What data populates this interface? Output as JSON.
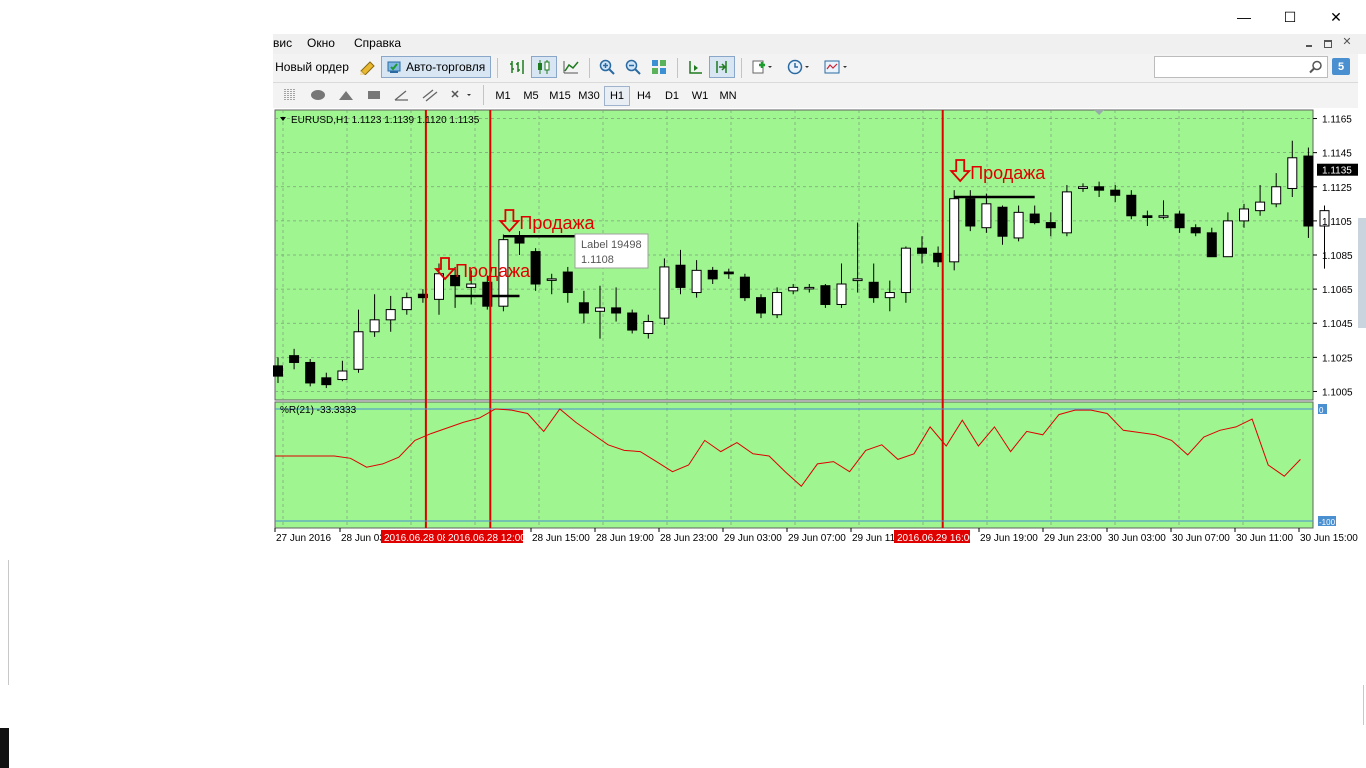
{
  "window": {
    "minimize_glyph": "—",
    "maximize_glyph": "☐",
    "close_glyph": "✕"
  },
  "menu": [
    {
      "label": "вис"
    },
    {
      "label": "Окно"
    },
    {
      "label": "Справка"
    }
  ],
  "toolbar": {
    "new_order_label": "Новый ордер",
    "autotrading_label": "Авто-торговля",
    "search_placeholder": "",
    "notification_count": "5"
  },
  "timeframes": [
    "M1",
    "M5",
    "M15",
    "M30",
    "H1",
    "H4",
    "D1",
    "W1",
    "MN"
  ],
  "active_timeframe": "H1",
  "chart_data": [
    {
      "type": "candlestick",
      "title": "EURUSD,H1  1.1123 1.1139 1.1120 1.1135",
      "price_scale": [
        "1.1165",
        "1.1145",
        "1.1125",
        "1.1105",
        "1.1085",
        "1.1065",
        "1.1045",
        "1.1025",
        "1.1005"
      ],
      "current_price": "1.1135",
      "y_range": [
        1.1,
        1.117
      ],
      "time_labels": [
        "27 Jun 2016",
        "28 Jun 03",
        "28 Jun 15:00",
        "28 Jun 19:00",
        "28 Jun 23:00",
        "29 Jun 03:00",
        "29 Jun 07:00",
        "29 Jun 11",
        "29 Jun 19:00",
        "29 Jun 23:00",
        "30 Jun 03:00",
        "30 Jun 07:00",
        "30 Jun 11:00",
        "30 Jun 15:00"
      ],
      "highlighted_times": [
        "2016.06.28 08",
        "2016.06.28 12:00",
        "2016.06.29 16:00"
      ],
      "candles": [
        [
          1.102,
          1.1014,
          1.1025,
          1.101
        ],
        [
          1.1026,
          1.1022,
          1.103,
          1.1018
        ],
        [
          1.1022,
          1.101,
          1.1024,
          1.1008
        ],
        [
          1.1013,
          1.1009,
          1.1016,
          1.1007
        ],
        [
          1.1012,
          1.1017,
          1.1023,
          1.1011
        ],
        [
          1.1018,
          1.104,
          1.1053,
          1.1016
        ],
        [
          1.104,
          1.1047,
          1.1062,
          1.1037
        ],
        [
          1.1047,
          1.1053,
          1.1061,
          1.104
        ],
        [
          1.1053,
          1.106,
          1.1063,
          1.105
        ],
        [
          1.1062,
          1.106,
          1.1065,
          1.1057
        ],
        [
          1.1059,
          1.1074,
          1.108,
          1.105
        ],
        [
          1.1073,
          1.1067,
          1.1078,
          1.1054
        ],
        [
          1.1066,
          1.1068,
          1.1076,
          1.1056
        ],
        [
          1.1069,
          1.1055,
          1.1073,
          1.1053
        ],
        [
          1.1055,
          1.1094,
          1.1097,
          1.1052
        ],
        [
          1.1096,
          1.1092,
          1.1099,
          1.1085
        ],
        [
          1.1087,
          1.1068,
          1.1089,
          1.1064
        ],
        [
          1.1071,
          1.1071,
          1.1074,
          1.1062
        ],
        [
          1.1075,
          1.1063,
          1.1078,
          1.1057
        ],
        [
          1.1057,
          1.1051,
          1.1064,
          1.1045
        ],
        [
          1.1052,
          1.1054,
          1.1067,
          1.1036
        ],
        [
          1.1054,
          1.1051,
          1.1066,
          1.1046
        ],
        [
          1.1051,
          1.1041,
          1.1053,
          1.1039
        ],
        [
          1.1039,
          1.1046,
          1.105,
          1.1036
        ],
        [
          1.1048,
          1.1078,
          1.1083,
          1.1044
        ],
        [
          1.1079,
          1.1066,
          1.1088,
          1.1062
        ],
        [
          1.1063,
          1.1076,
          1.1082,
          1.106
        ],
        [
          1.1076,
          1.1071,
          1.1078,
          1.1068
        ],
        [
          1.1075,
          1.1074,
          1.1077,
          1.1071
        ],
        [
          1.1072,
          1.106,
          1.1074,
          1.1058
        ],
        [
          1.106,
          1.1051,
          1.1062,
          1.1048
        ],
        [
          1.105,
          1.1063,
          1.1066,
          1.1048
        ],
        [
          1.1064,
          1.1066,
          1.1068,
          1.1062
        ],
        [
          1.1066,
          1.1066,
          1.1068,
          1.1063
        ],
        [
          1.1067,
          1.1056,
          1.1068,
          1.1054
        ],
        [
          1.1056,
          1.1068,
          1.108,
          1.1054
        ],
        [
          1.107,
          1.1071,
          1.1104,
          1.1063
        ],
        [
          1.1069,
          1.106,
          1.108,
          1.1057
        ],
        [
          1.106,
          1.1063,
          1.107,
          1.1052
        ],
        [
          1.1063,
          1.1089,
          1.109,
          1.1057
        ],
        [
          1.1089,
          1.1086,
          1.1096,
          1.108
        ],
        [
          1.1086,
          1.1081,
          1.109,
          1.1078
        ],
        [
          1.1081,
          1.1118,
          1.1123,
          1.1076
        ],
        [
          1.1118,
          1.1102,
          1.1123,
          1.1099
        ],
        [
          1.1101,
          1.1115,
          1.1121,
          1.1098
        ],
        [
          1.1113,
          1.1096,
          1.1114,
          1.1091
        ],
        [
          1.1095,
          1.111,
          1.1114,
          1.1093
        ],
        [
          1.1109,
          1.1104,
          1.1114,
          1.1103
        ],
        [
          1.1104,
          1.1101,
          1.111,
          1.1096
        ],
        [
          1.1098,
          1.1122,
          1.1126,
          1.1096
        ],
        [
          1.1124,
          1.1125,
          1.1127,
          1.1122
        ],
        [
          1.1125,
          1.1123,
          1.1128,
          1.1119
        ],
        [
          1.1123,
          1.112,
          1.1126,
          1.1116
        ],
        [
          1.112,
          1.1108,
          1.1123,
          1.1106
        ],
        [
          1.1108,
          1.1107,
          1.1111,
          1.1102
        ],
        [
          1.1108,
          1.1108,
          1.1117,
          1.1106
        ],
        [
          1.1109,
          1.1101,
          1.1111,
          1.1098
        ],
        [
          1.1101,
          1.1098,
          1.1103,
          1.1096
        ],
        [
          1.1098,
          1.1084,
          1.1101,
          1.1084
        ],
        [
          1.1084,
          1.1105,
          1.111,
          1.1084
        ],
        [
          1.1105,
          1.1112,
          1.1115,
          1.1101
        ],
        [
          1.1111,
          1.1116,
          1.1126,
          1.1108
        ],
        [
          1.1115,
          1.1125,
          1.1133,
          1.1113
        ],
        [
          1.1124,
          1.1142,
          1.1152,
          1.1119
        ],
        [
          1.1143,
          1.1102,
          1.1148,
          1.1095
        ],
        [
          1.1102,
          1.1111,
          1.1114,
          1.1077
        ]
      ],
      "annotations": [
        {
          "text": "Продажа",
          "bar": 10
        },
        {
          "text": "Продажа",
          "bar": 14
        },
        {
          "text": "Продажа",
          "bar": 42
        }
      ],
      "tooltip": {
        "line1": "Label 19498",
        "line2": "1.1108"
      }
    },
    {
      "type": "line",
      "title": "%R(21) -33.3333",
      "y_range": [
        -100,
        0
      ],
      "scale_labels": [
        "0",
        "-100"
      ],
      "series": [
        {
          "values": [
            -42,
            -44,
            -52,
            -49,
            -43,
            -28,
            -22,
            -17,
            -12,
            -8,
            0,
            -1,
            -4,
            -20,
            0,
            -12,
            -22,
            -32,
            -37,
            -38,
            -47,
            -56,
            -50,
            -28,
            -38,
            -30,
            -40,
            -42,
            -56,
            -69,
            -49,
            -47,
            -56,
            -37,
            -32,
            -45,
            -40,
            -16,
            -33,
            -10,
            -33,
            -16,
            -38,
            -20,
            -23,
            -5,
            -1,
            -1,
            -4,
            -19,
            -21,
            -23,
            -28,
            -41,
            -25,
            -19,
            -16,
            -9,
            -50,
            -60,
            -45
          ]
        }
      ]
    }
  ]
}
